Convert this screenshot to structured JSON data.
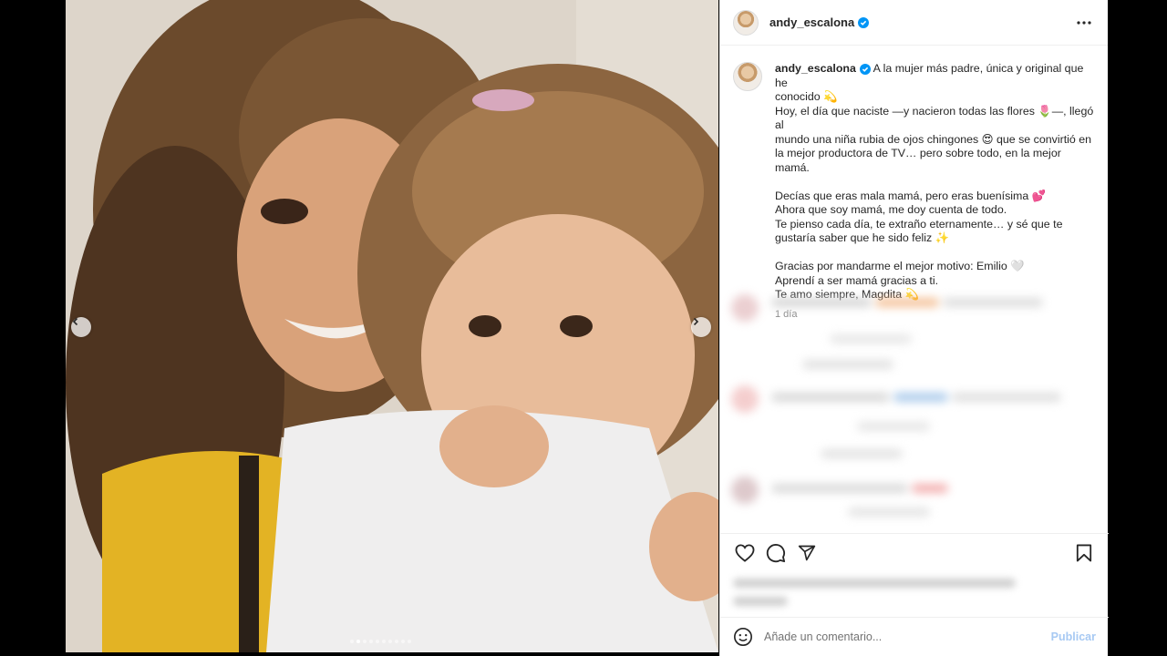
{
  "post": {
    "username": "andy_escalona",
    "verified": true,
    "time_ago": "1 día",
    "caption_first_line": "A la mujer más padre, única y original que he",
    "caption_lines": [
      "conocido 💫",
      "Hoy, el día que naciste —y nacieron todas las flores 🌷—, llegó al",
      "mundo una niña rubia de ojos chingones 😍 que se convirtió en",
      "la mejor productora de TV… pero sobre todo, en la mejor mamá.",
      "",
      "Decías que eras mala mamá, pero eras buenísima 💕",
      "Ahora que soy mamá, me doy cuenta de todo.",
      "Te pienso cada día, te extraño eternamente… y sé que te",
      "gustaría saber que he sido feliz ✨",
      "",
      "Gracias por mandarme el mejor motivo: Emilio 🤍",
      "Aprendí a ser mamá gracias a ti.",
      "Te amo siempre, Magdita 💫"
    ]
  },
  "carousel": {
    "slide_count": 10,
    "active_index": 1
  },
  "icons": {
    "verified": "verified-badge-icon",
    "more": "more-options-icon",
    "like": "heart-icon",
    "comment": "comment-icon",
    "share": "share-icon",
    "save": "bookmark-icon",
    "emoji": "emoji-icon",
    "prev": "chevron-left-icon",
    "next": "chevron-right-icon"
  },
  "add_comment": {
    "placeholder": "Añade un comentario...",
    "publish_label": "Publicar"
  },
  "colors": {
    "verified_blue": "#0095f6",
    "publish_disabled": "#a7c9f3",
    "text": "#262626",
    "muted": "#8e8e8e"
  }
}
